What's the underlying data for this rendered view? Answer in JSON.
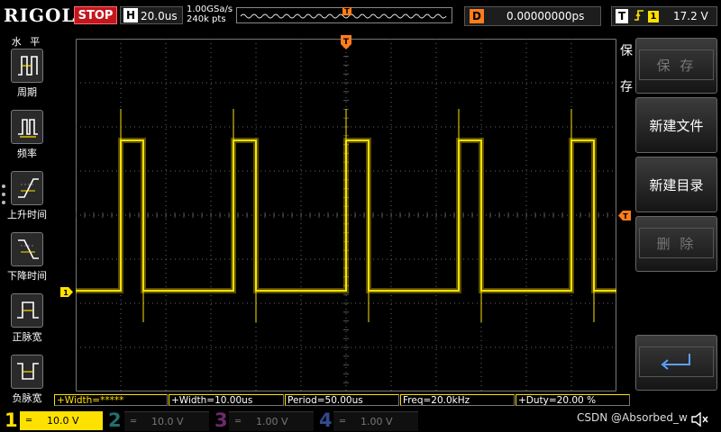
{
  "topbar": {
    "logo": "RIGOL",
    "run_state": "STOP",
    "timebase_label": "H",
    "timebase_value": "20.0us",
    "sample_rate": "1.00GSa/s",
    "memory_depth": "240k pts",
    "trigger_marker": "T",
    "delay_label": "D",
    "delay_value": "0.00000000ps",
    "trigger_label": "T",
    "trigger_edge": "rising-edge-icon",
    "trigger_source": "1",
    "trigger_level": "17.2 V"
  },
  "left_menu": {
    "title": "水 平",
    "items": [
      {
        "label": "周期",
        "icon": "period-icon"
      },
      {
        "label": "频率",
        "icon": "frequency-icon"
      },
      {
        "label": "上升时间",
        "icon": "rise-time-icon"
      },
      {
        "label": "下降时间",
        "icon": "fall-time-icon"
      },
      {
        "label": "正脉宽",
        "icon": "positive-width-icon"
      },
      {
        "label": "负脉宽",
        "icon": "negative-width-icon"
      }
    ]
  },
  "waveform": {
    "channel_marker": "1",
    "trigger_time_marker": "T",
    "trigger_level_marker": "T",
    "color": "#ffe100",
    "trigger_color": "#ff7d1a",
    "period_us": 50.0,
    "positive_width_us": 10.0,
    "duty_percent": 20.0,
    "pulse_count": 5
  },
  "right_menu": {
    "title_top": "保",
    "title_bottom": "存",
    "buttons": [
      {
        "label": "保 存",
        "enabled": false
      },
      {
        "label": "新建文件",
        "enabled": true
      },
      {
        "label": "新建目录",
        "enabled": true
      },
      {
        "label": "删 除",
        "enabled": false
      },
      {
        "label": "",
        "icon": "enter-arrow-icon",
        "enabled": true
      }
    ]
  },
  "measurements": [
    "+Width=*****",
    "+Width=10.00us",
    "Period=50.00us",
    "Freq=20.0kHz",
    "+Duty=20.00 %"
  ],
  "channels": [
    {
      "num": "1",
      "symbol": "═",
      "scale": "10.0 V",
      "active": true,
      "color": "#ffe100"
    },
    {
      "num": "2",
      "symbol": "═",
      "scale": "10.0 V",
      "active": false,
      "color": "#1fc7c7"
    },
    {
      "num": "3",
      "symbol": "═",
      "scale": "1.00 V",
      "active": false,
      "color": "#d33fd3"
    },
    {
      "num": "4",
      "symbol": "═",
      "scale": "1.00 V",
      "active": false,
      "color": "#3b6ff0"
    }
  ],
  "watermark": "CSDN @Absorbed_w"
}
